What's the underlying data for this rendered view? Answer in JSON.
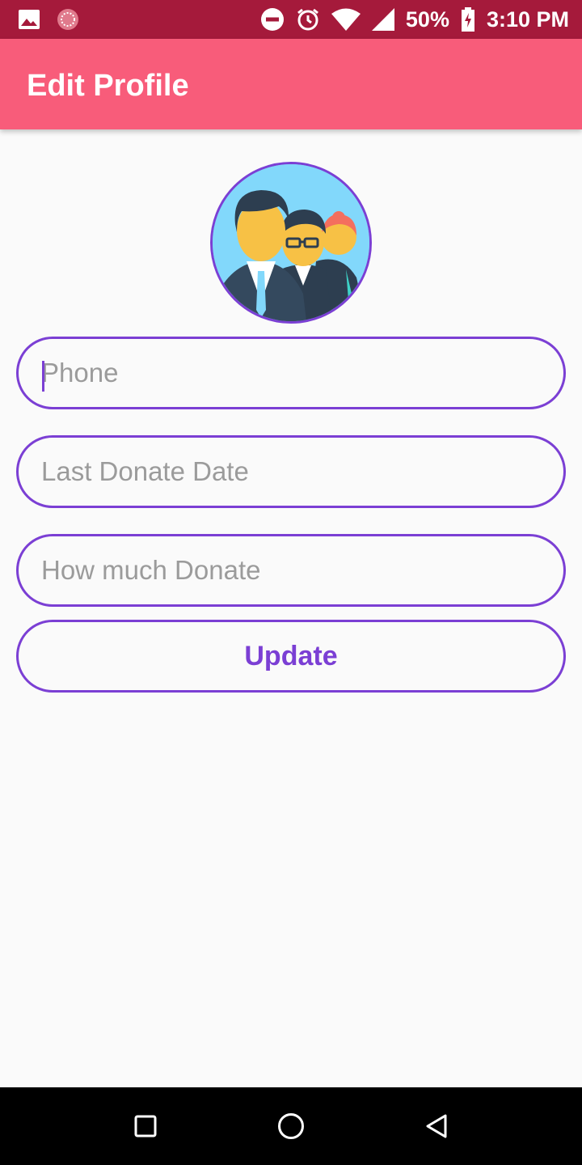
{
  "status_bar": {
    "battery_percent": "50%",
    "time": "3:10 PM",
    "icons": [
      "image-icon",
      "app-notification-icon",
      "do-not-disturb-icon",
      "alarm-icon",
      "wifi-icon",
      "cell-signal-icon",
      "battery-charging-icon"
    ]
  },
  "app_bar": {
    "title": "Edit Profile"
  },
  "avatar": {
    "icon": "people-group-icon"
  },
  "form": {
    "phone_placeholder": "Phone",
    "last_donate_placeholder": "Last Donate Date",
    "how_much_placeholder": "How much Donate",
    "update_label": "Update"
  },
  "colors": {
    "status_bar": "#a51a3b",
    "app_bar": "#f85c7a",
    "accent": "#7b3fd4",
    "background": "#fafafa"
  },
  "nav_bar": {
    "icons": [
      "recent-apps-icon",
      "home-icon",
      "back-icon"
    ]
  }
}
